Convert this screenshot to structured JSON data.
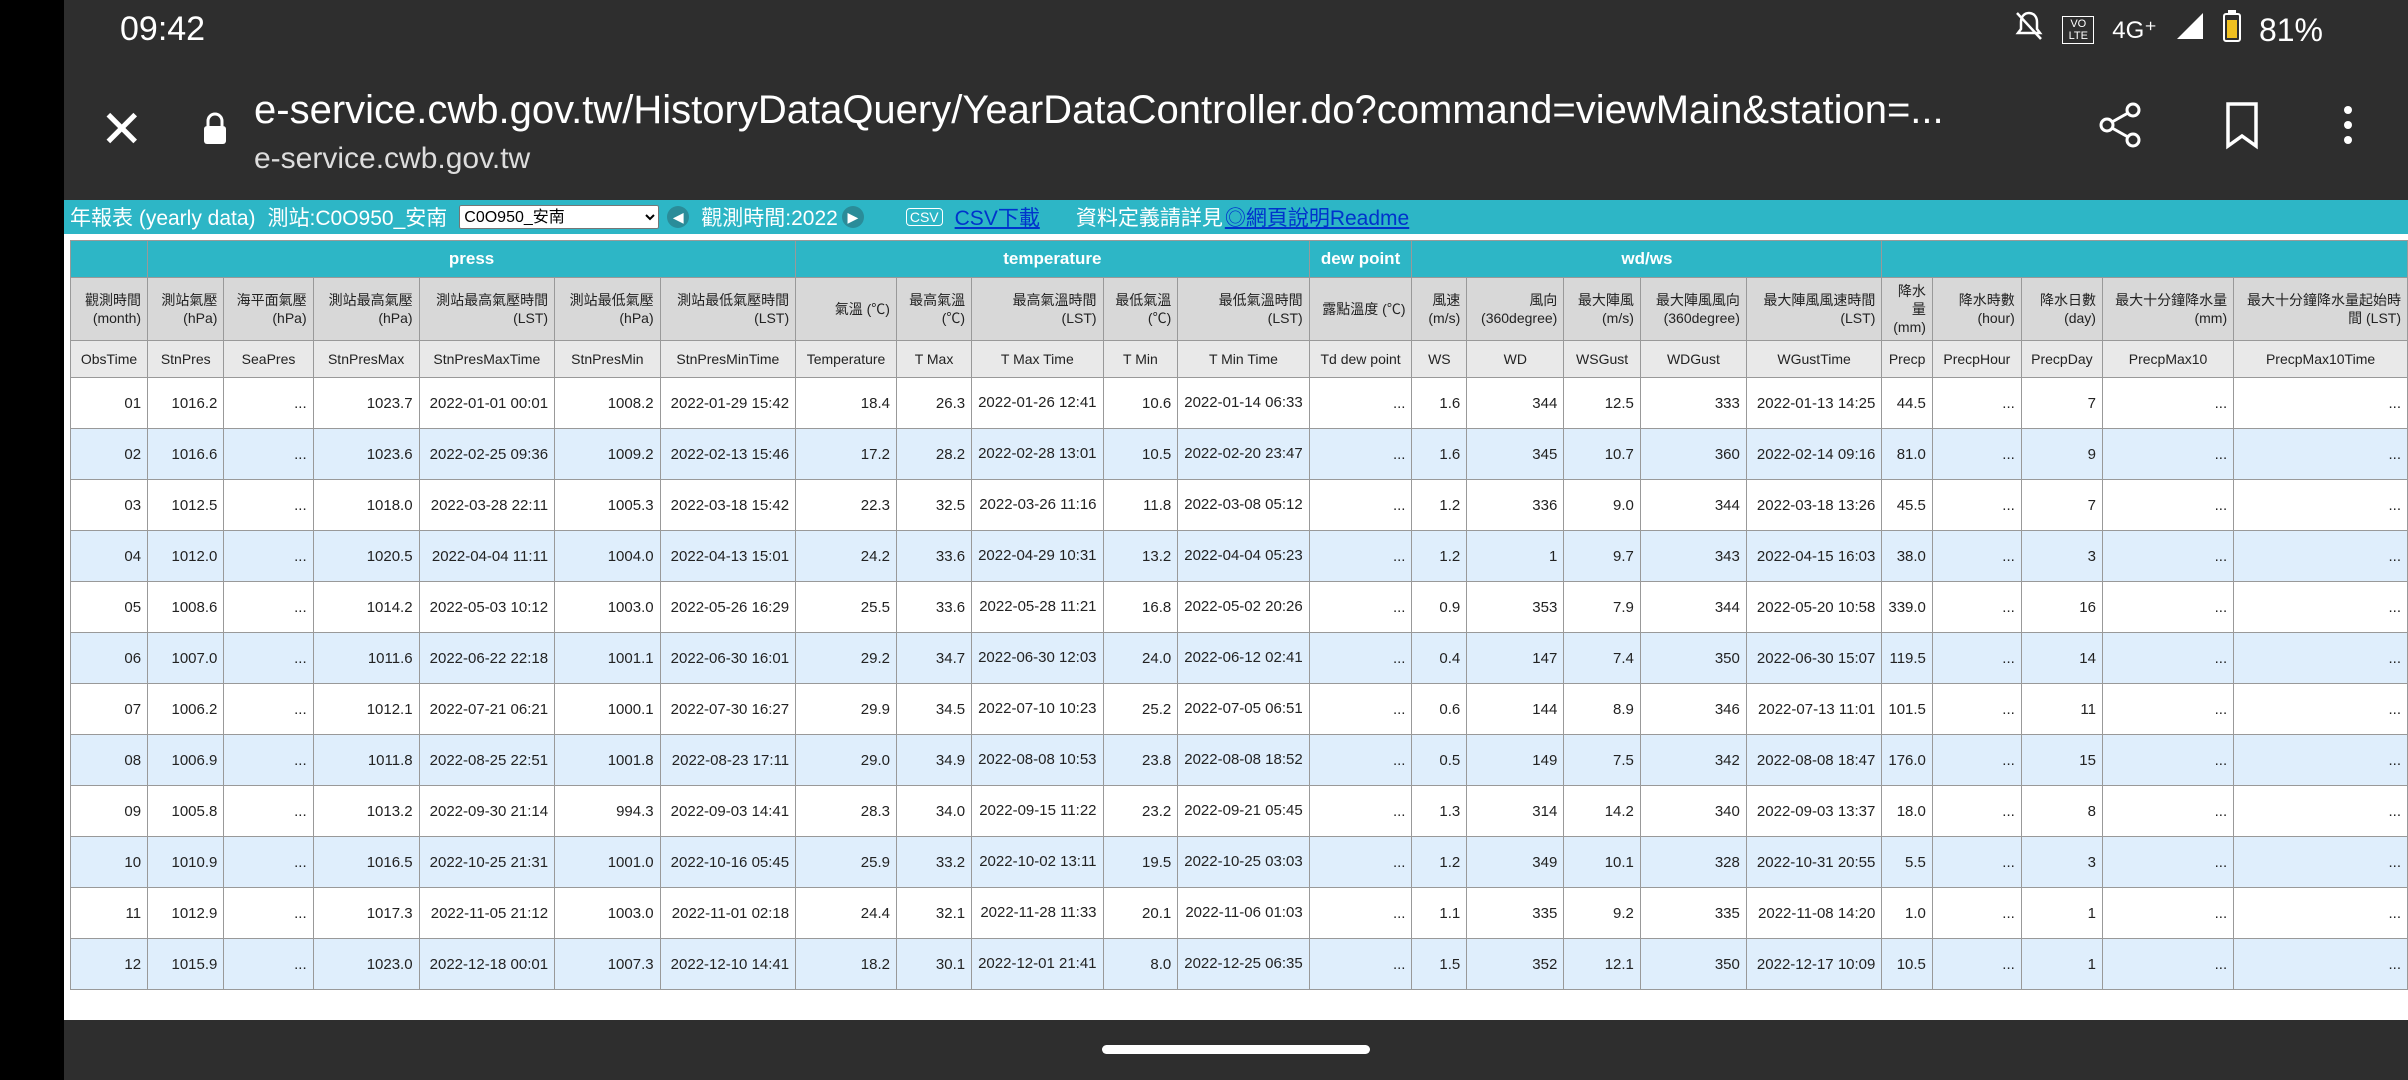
{
  "status": {
    "time": "09:42",
    "network": "4G⁺",
    "vo": "VO LTE",
    "battery": "81%"
  },
  "browser": {
    "url": "e-service.cwb.gov.tw/HistoryDataQuery/YearDataController.do?command=viewMain&station=...",
    "domain": "e-service.cwb.gov.tw"
  },
  "toolbar": {
    "title": "年報表 (yearly data)",
    "station_label": "測站:C0O950_安南",
    "station_select": "C0O950_安南",
    "obs_time": "觀測時間:2022",
    "csv_icon": "CSV",
    "csv_link": "CSV下載",
    "readme_text": "資料定義請詳見",
    "readme_link": "◎網頁說明Readme"
  },
  "table": {
    "groups": [
      "",
      "press",
      "temperature",
      "dew point",
      "wd/ws",
      ""
    ],
    "headers_cn": [
      "觀測時間 (month)",
      "測站氣壓 (hPa)",
      "海平面氣壓 (hPa)",
      "測站最高氣壓 (hPa)",
      "測站最高氣壓時間 (LST)",
      "測站最低氣壓 (hPa)",
      "測站最低氣壓時間 (LST)",
      "氣溫 (℃)",
      "最高氣溫 (℃)",
      "最高氣溫時間 (LST)",
      "最低氣溫 (℃)",
      "最低氣溫時間 (LST)",
      "露點溫度 (℃)",
      "風速 (m/s)",
      "風向 (360degree)",
      "最大陣風 (m/s)",
      "最大陣風風向 (360degree)",
      "最大陣風風速時間 (LST)",
      "降水量 (mm)",
      "降水時數 (hour)",
      "降水日數 (day)",
      "最大十分鐘降水量 (mm)",
      "最大十分鐘降水量起始時間 (LST)"
    ],
    "headers_en": [
      "ObsTime",
      "StnPres",
      "SeaPres",
      "StnPresMax",
      "StnPresMaxTime",
      "StnPresMin",
      "StnPresMinTime",
      "Temperature",
      "T Max",
      "T Max Time",
      "T Min",
      "T Min Time",
      "Td dew point",
      "WS",
      "WD",
      "WSGust",
      "WDGust",
      "WGustTime",
      "Precp",
      "PrecpHour",
      "PrecpDay",
      "PrecpMax10",
      "PrecpMax10Time"
    ],
    "rows": [
      [
        "01",
        "1016.2",
        "...",
        "1023.7",
        "2022-01-01 00:01",
        "1008.2",
        "2022-01-29 15:42",
        "18.4",
        "26.3",
        "2022-01-26 12:41",
        "10.6",
        "2022-01-14 06:33",
        "...",
        "1.6",
        "344",
        "12.5",
        "333",
        "2022-01-13 14:25",
        "44.5",
        "...",
        "7",
        "...",
        "..."
      ],
      [
        "02",
        "1016.6",
        "...",
        "1023.6",
        "2022-02-25 09:36",
        "1009.2",
        "2022-02-13 15:46",
        "17.2",
        "28.2",
        "2022-02-28 13:01",
        "10.5",
        "2022-02-20 23:47",
        "...",
        "1.6",
        "345",
        "10.7",
        "360",
        "2022-02-14 09:16",
        "81.0",
        "...",
        "9",
        "...",
        "..."
      ],
      [
        "03",
        "1012.5",
        "...",
        "1018.0",
        "2022-03-28 22:11",
        "1005.3",
        "2022-03-18 15:42",
        "22.3",
        "32.5",
        "2022-03-26 11:16",
        "11.8",
        "2022-03-08 05:12",
        "...",
        "1.2",
        "336",
        "9.0",
        "344",
        "2022-03-18 13:26",
        "45.5",
        "...",
        "7",
        "...",
        "..."
      ],
      [
        "04",
        "1012.0",
        "...",
        "1020.5",
        "2022-04-04 11:11",
        "1004.0",
        "2022-04-13 15:01",
        "24.2",
        "33.6",
        "2022-04-29 10:31",
        "13.2",
        "2022-04-04 05:23",
        "...",
        "1.2",
        "1",
        "9.7",
        "343",
        "2022-04-15 16:03",
        "38.0",
        "...",
        "3",
        "...",
        "..."
      ],
      [
        "05",
        "1008.6",
        "...",
        "1014.2",
        "2022-05-03 10:12",
        "1003.0",
        "2022-05-26 16:29",
        "25.5",
        "33.6",
        "2022-05-28 11:21",
        "16.8",
        "2022-05-02 20:26",
        "...",
        "0.9",
        "353",
        "7.9",
        "344",
        "2022-05-20 10:58",
        "339.0",
        "...",
        "16",
        "...",
        "..."
      ],
      [
        "06",
        "1007.0",
        "...",
        "1011.6",
        "2022-06-22 22:18",
        "1001.1",
        "2022-06-30 16:01",
        "29.2",
        "34.7",
        "2022-06-30 12:03",
        "24.0",
        "2022-06-12 02:41",
        "...",
        "0.4",
        "147",
        "7.4",
        "350",
        "2022-06-30 15:07",
        "119.5",
        "...",
        "14",
        "...",
        "..."
      ],
      [
        "07",
        "1006.2",
        "...",
        "1012.1",
        "2022-07-21 06:21",
        "1000.1",
        "2022-07-30 16:27",
        "29.9",
        "34.5",
        "2022-07-10 10:23",
        "25.2",
        "2022-07-05 06:51",
        "...",
        "0.6",
        "144",
        "8.9",
        "346",
        "2022-07-13 11:01",
        "101.5",
        "...",
        "11",
        "...",
        "..."
      ],
      [
        "08",
        "1006.9",
        "...",
        "1011.8",
        "2022-08-25 22:51",
        "1001.8",
        "2022-08-23 17:11",
        "29.0",
        "34.9",
        "2022-08-08 10:53",
        "23.8",
        "2022-08-08 18:52",
        "...",
        "0.5",
        "149",
        "7.5",
        "342",
        "2022-08-08 18:47",
        "176.0",
        "...",
        "15",
        "...",
        "..."
      ],
      [
        "09",
        "1005.8",
        "...",
        "1013.2",
        "2022-09-30 21:14",
        "994.3",
        "2022-09-03 14:41",
        "28.3",
        "34.0",
        "2022-09-15 11:22",
        "23.2",
        "2022-09-21 05:45",
        "...",
        "1.3",
        "314",
        "14.2",
        "340",
        "2022-09-03 13:37",
        "18.0",
        "...",
        "8",
        "...",
        "..."
      ],
      [
        "10",
        "1010.9",
        "...",
        "1016.5",
        "2022-10-25 21:31",
        "1001.0",
        "2022-10-16 05:45",
        "25.9",
        "33.2",
        "2022-10-02 13:11",
        "19.5",
        "2022-10-25 03:03",
        "...",
        "1.2",
        "349",
        "10.1",
        "328",
        "2022-10-31 20:55",
        "5.5",
        "...",
        "3",
        "...",
        "..."
      ],
      [
        "11",
        "1012.9",
        "...",
        "1017.3",
        "2022-11-05 21:12",
        "1003.0",
        "2022-11-01 02:18",
        "24.4",
        "32.1",
        "2022-11-28 11:33",
        "20.1",
        "2022-11-06 01:03",
        "...",
        "1.1",
        "335",
        "9.2",
        "335",
        "2022-11-08 14:20",
        "1.0",
        "...",
        "1",
        "...",
        "..."
      ],
      [
        "12",
        "1015.9",
        "...",
        "1023.0",
        "2022-12-18 00:01",
        "1007.3",
        "2022-12-10 14:41",
        "18.2",
        "30.1",
        "2022-12-01 21:41",
        "8.0",
        "2022-12-25 06:35",
        "...",
        "1.5",
        "352",
        "12.1",
        "350",
        "2022-12-17 10:09",
        "10.5",
        "...",
        "1",
        "...",
        "..."
      ]
    ]
  }
}
